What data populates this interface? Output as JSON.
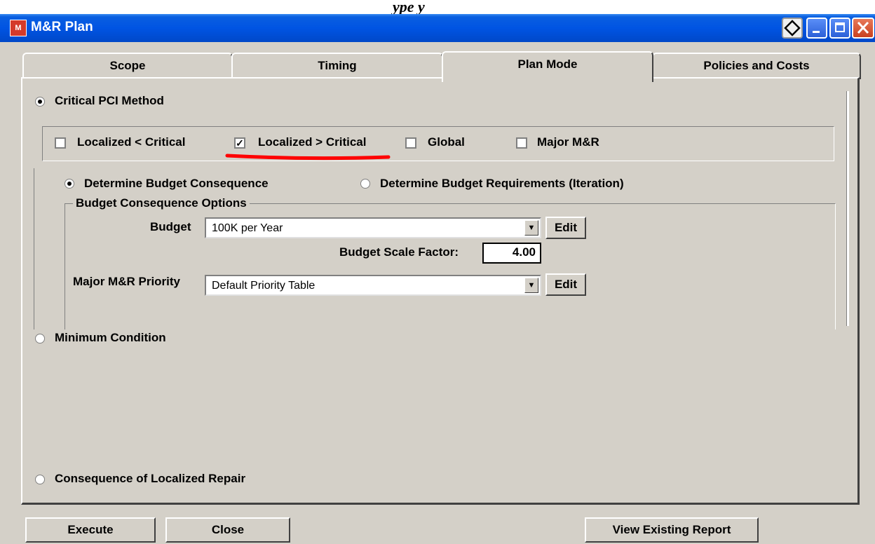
{
  "window": {
    "title": "M&R Plan",
    "title_icon": "mr-app-icon"
  },
  "tabs": [
    {
      "label": "Scope"
    },
    {
      "label": "Timing"
    },
    {
      "label": "Plan Mode"
    },
    {
      "label": "Policies and Costs"
    }
  ],
  "plan_mode": {
    "critical_pci": {
      "label": "Critical PCI Method",
      "selected": true
    },
    "checkboxes": {
      "localized_lt": {
        "label": "Localized < Critical",
        "checked": false
      },
      "localized_gt": {
        "label": "Localized > Critical",
        "checked": true
      },
      "global": {
        "label": "Global",
        "checked": false
      },
      "major_mr": {
        "label": "Major M&R",
        "checked": false
      }
    },
    "determine_consequence": {
      "label": "Determine Budget Consequence",
      "selected": true
    },
    "determine_requirements": {
      "label": "Determine Budget Requirements (Iteration)",
      "selected": false
    },
    "options_group_label": "Budget Consequence Options",
    "budget_label": "Budget",
    "budget_value": "100K per Year",
    "edit_label": "Edit",
    "scale_label": "Budget Scale Factor:",
    "scale_value": "4.00",
    "priority_label": "Major M&R Priority",
    "priority_value": "Default Priority Table",
    "minimum_condition": {
      "label": "Minimum Condition",
      "selected": false
    },
    "consequence_localized": {
      "label": "Consequence of Localized Repair",
      "selected": false
    }
  },
  "footer": {
    "execute": "Execute",
    "close": "Close",
    "view_report": "View Existing Report"
  },
  "annotation_color": "#ff0000",
  "partial_heading": "ype  y"
}
